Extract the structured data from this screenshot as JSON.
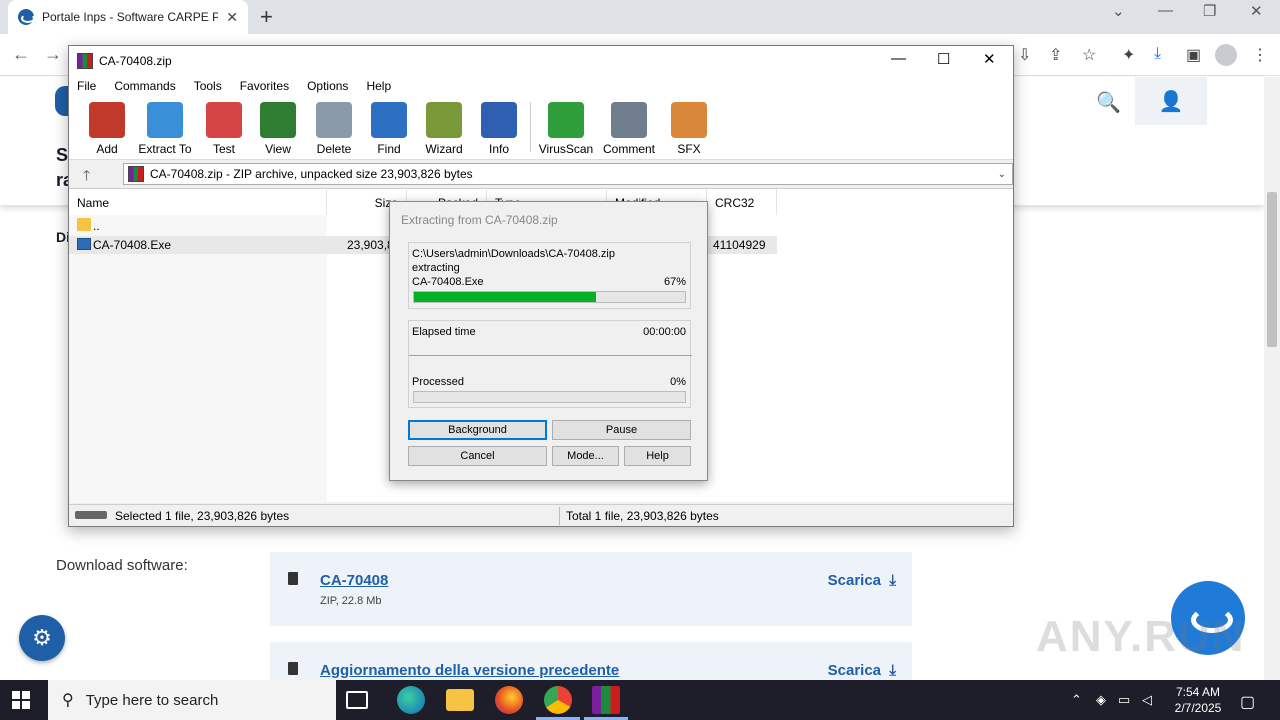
{
  "browser": {
    "tab_title": "Portale Inps - Software CARPE P",
    "tab_close": "✕",
    "new_tab": "+",
    "window_controls": [
      "⌄",
      "—",
      "❐",
      "✕"
    ],
    "nav": {
      "back": "←",
      "forward": "→"
    }
  },
  "site": {
    "fragments": [
      "S",
      "ra",
      "Di"
    ],
    "search_icon": "🔍",
    "user_icon": "👤",
    "download_title": "Download software:",
    "downloads": [
      {
        "name": "CA-70408",
        "meta": "ZIP, 22.8 Mb",
        "action": "Scarica"
      },
      {
        "name": "Aggiornamento della versione precedente",
        "meta": "",
        "action": "Scarica"
      }
    ],
    "download_arrow": "⤓",
    "gear": "⚙",
    "watermark": "ANY.RUN"
  },
  "winrar": {
    "title": "CA-70408.zip",
    "window_controls": [
      "—",
      "☐",
      "✕"
    ],
    "menu": [
      "File",
      "Commands",
      "Tools",
      "Favorites",
      "Options",
      "Help"
    ],
    "toolbar": [
      {
        "label": "Add",
        "color": "#c0392b"
      },
      {
        "label": "Extract To",
        "color": "#3a8fd9"
      },
      {
        "label": "Test",
        "color": "#d64545"
      },
      {
        "label": "View",
        "color": "#2f7d32"
      },
      {
        "label": "Delete",
        "color": "#8a9aa8"
      },
      {
        "label": "Find",
        "color": "#2d6fc2"
      },
      {
        "label": "Wizard",
        "color": "#7a9a3a"
      },
      {
        "label": "Info",
        "color": "#2f5fb0"
      },
      {
        "label": "VirusScan",
        "color": "#2e9e3a"
      },
      {
        "label": "Comment",
        "color": "#6f7d8c"
      },
      {
        "label": "SFX",
        "color": "#d9873a"
      }
    ],
    "address": "CA-70408.zip - ZIP archive, unpacked size 23,903,826 bytes",
    "up_arrow": "🡑",
    "dropdown": "⌄",
    "columns": [
      "Name",
      "Size",
      "Packed",
      "Type",
      "Modified",
      "CRC32"
    ],
    "rows": [
      {
        "name": "..",
        "size": "",
        "crc": ""
      },
      {
        "name": "CA-70408.Exe",
        "size": "23,903,8",
        "crc": "41104929"
      }
    ],
    "status_left": "Selected 1 file, 23,903,826 bytes",
    "status_right": "Total 1 file, 23,903,826 bytes"
  },
  "extract_dialog": {
    "title": "Extracting from CA-70408.zip",
    "path": "C:\\Users\\admin\\Downloads\\CA-70408.zip",
    "action": "extracting",
    "file": "CA-70408.Exe",
    "file_percent": "67%",
    "file_progress": 0.67,
    "elapsed_label": "Elapsed time",
    "elapsed_value": "00:00:00",
    "processed_label": "Processed",
    "processed_percent": "0%",
    "processed_progress": 0,
    "buttons": {
      "background": "Background",
      "pause": "Pause",
      "cancel": "Cancel",
      "mode": "Mode...",
      "help": "Help"
    }
  },
  "taskbar": {
    "search_placeholder": "Type here to search",
    "search_icon": "⚲",
    "apps": [
      "task-view",
      "edge",
      "file-explorer",
      "firefox",
      "chrome",
      "winrar"
    ],
    "tray_chevron": "⌃",
    "time": "7:54 AM",
    "date": "2/7/2025"
  }
}
